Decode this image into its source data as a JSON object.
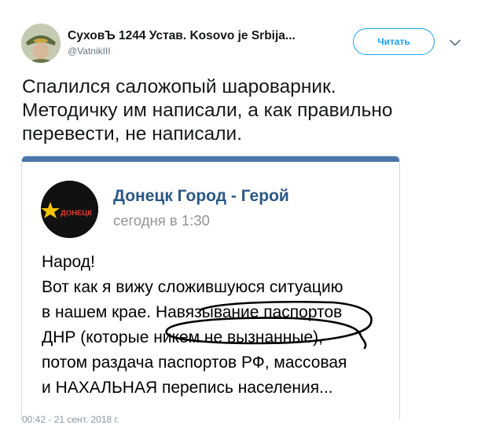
{
  "tweet": {
    "author_name": "СуховЪ 1244 Устав. Kosovo je Srbija...",
    "author_handle": "@VatnikIII",
    "follow_label": "Читать",
    "text_lines": [
      "Спалился саложопый шароварник.",
      "Методичку им написали, а как правильно",
      "перевести, не написали."
    ],
    "timestamp": "00:42 - 21 сент. 2018 г."
  },
  "embedded_post": {
    "group_name": "Донецк Город - Герой",
    "group_avatar_text": "ДОНЕЦК",
    "posted_time": "сегодня в 1:30",
    "body_lines": [
      "Народ!",
      "Вот как я вижу сложившуюся ситуацию",
      "в нашем крае. Навязывание паспортов",
      "ДНР (которые никем не вызнанные),",
      "потом раздача паспортов РФ, массовая",
      "и НАХАЛЬНАЯ перепись населения..."
    ]
  },
  "colors": {
    "accent": "#1da1f2",
    "vk_blue": "#4a76a8",
    "group_link": "#2a5885",
    "scribble_ink": "#000000"
  },
  "icons": {
    "more": "chevron-down-icon",
    "emblem": "star-icon"
  }
}
